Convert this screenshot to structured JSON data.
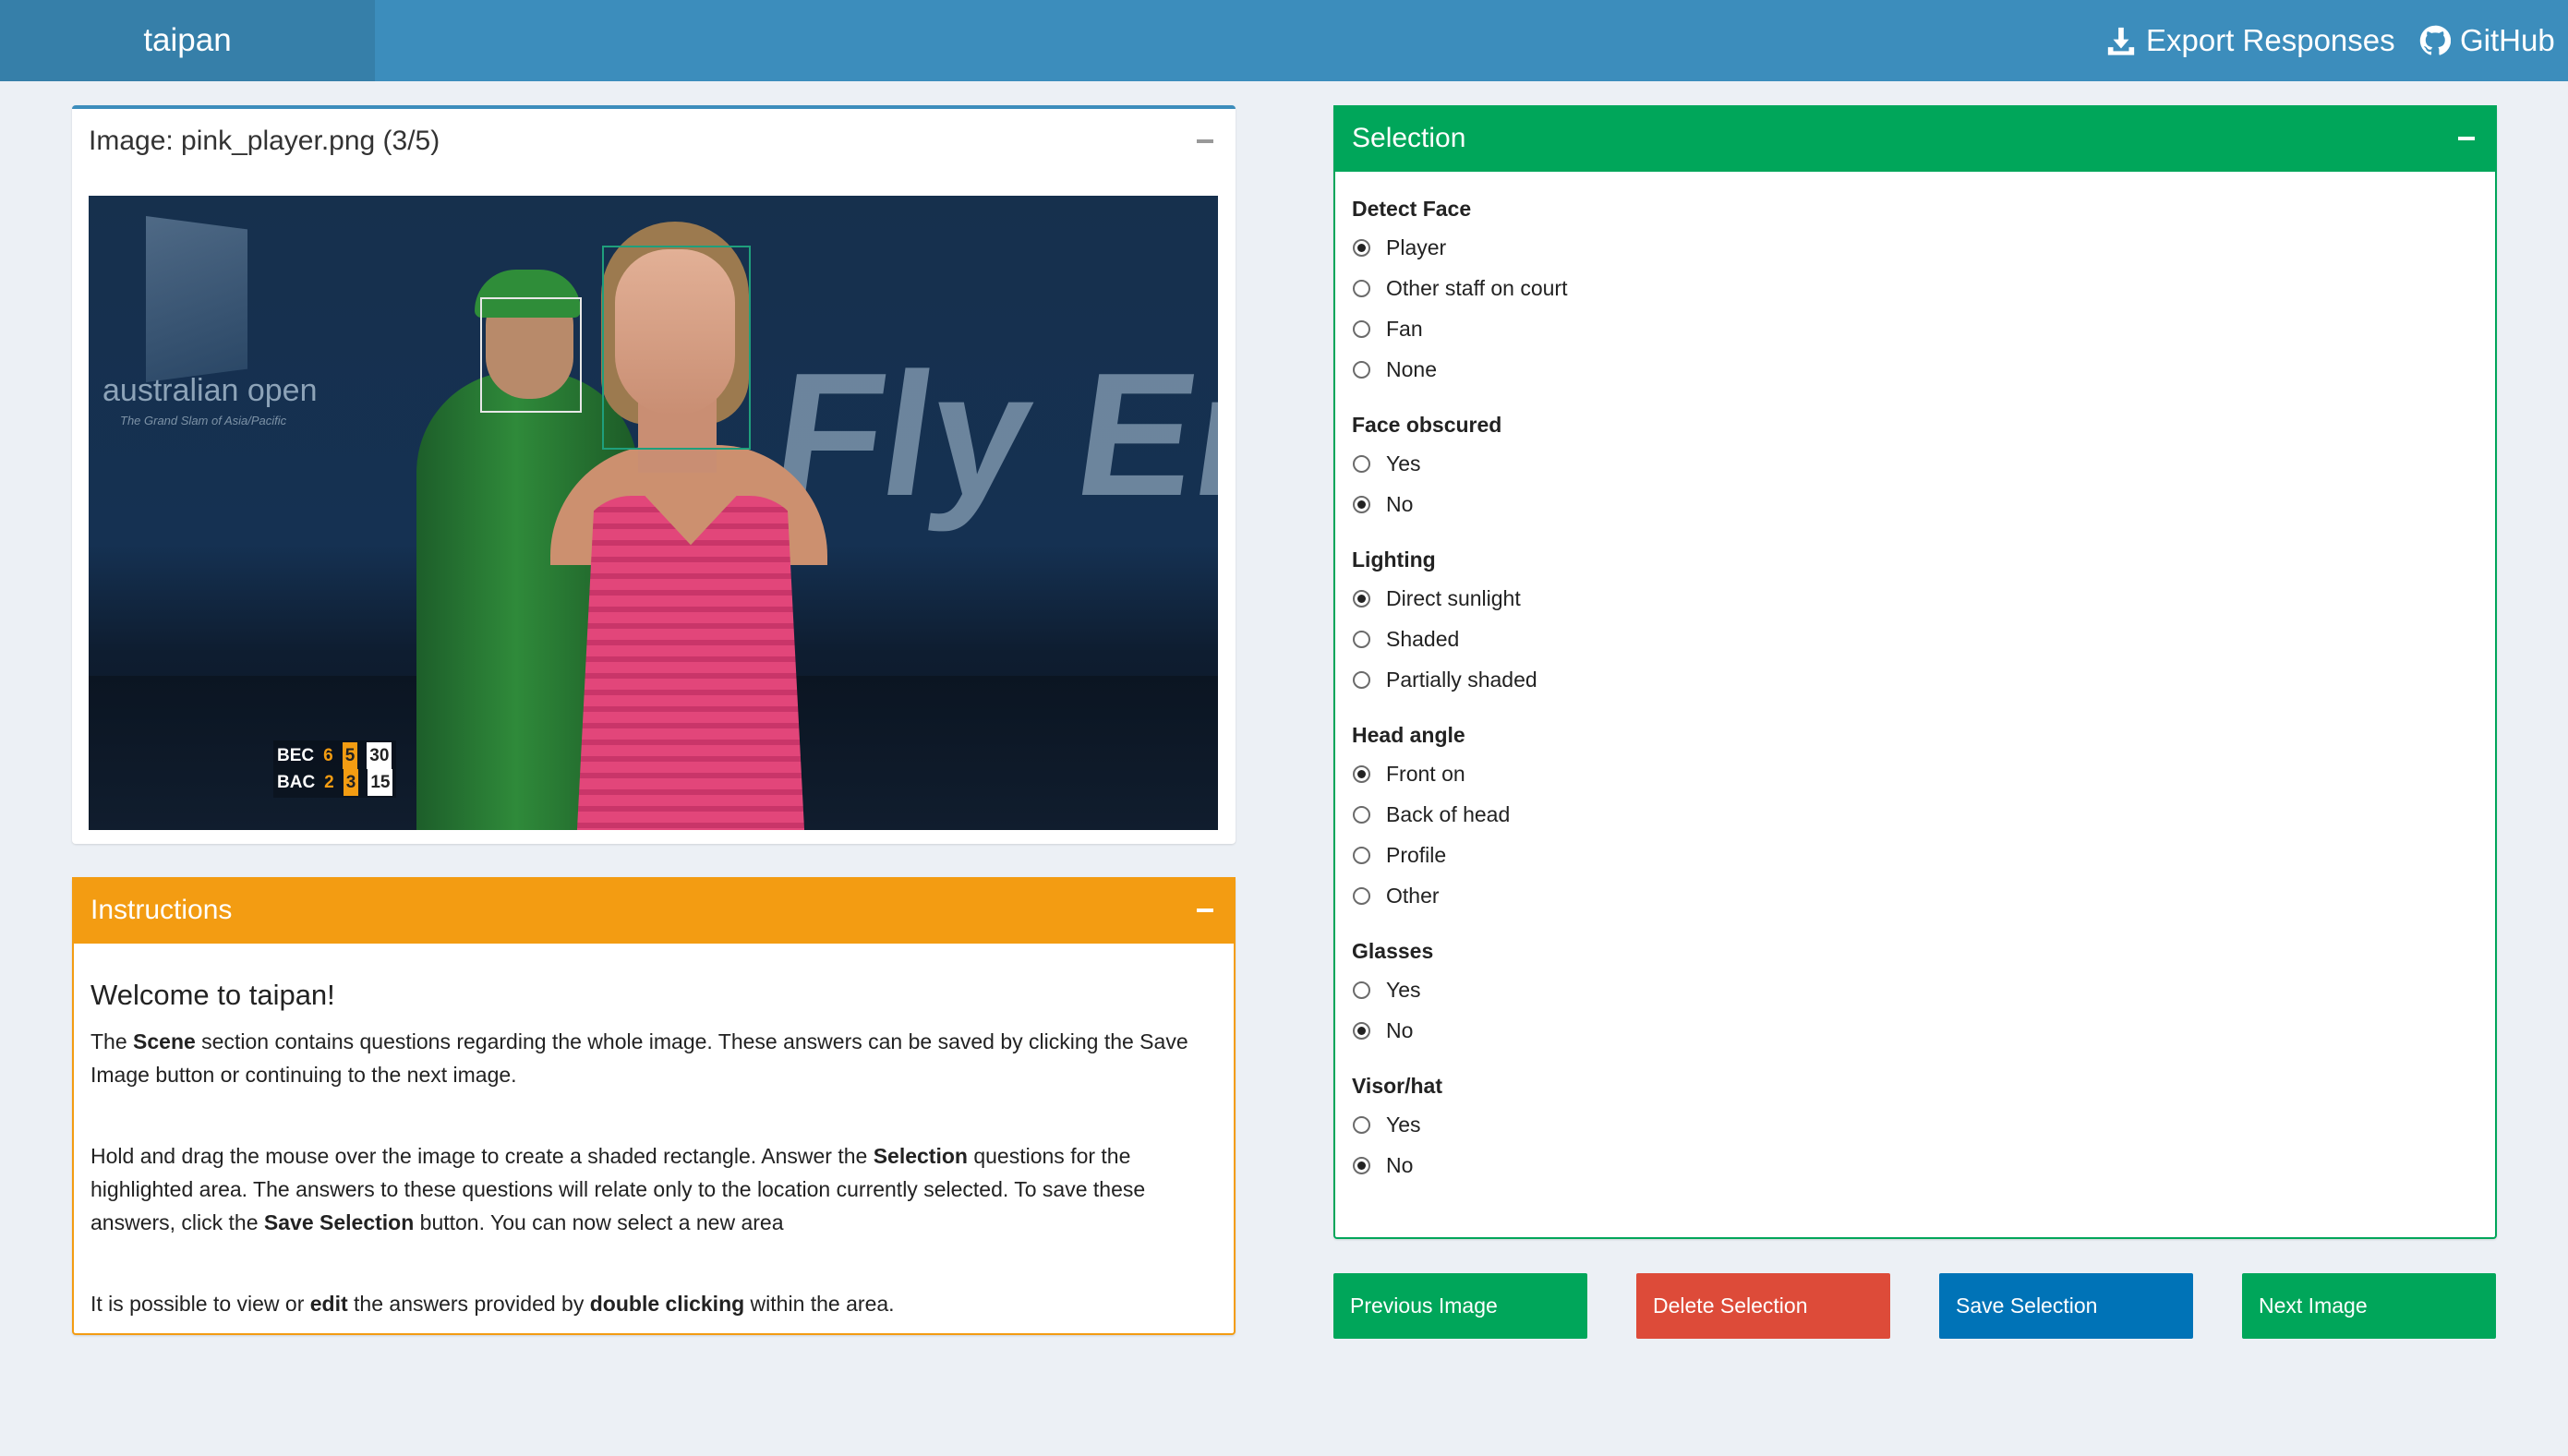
{
  "app": {
    "brand": "taipan"
  },
  "nav": {
    "export_label": "Export Responses",
    "export_icon": "download-icon",
    "github_label": "GitHub",
    "github_icon": "github-icon"
  },
  "image_panel": {
    "title": "Image: pink_player.png (3/5)",
    "overlay": {
      "logo_text": "australian open",
      "logo_subtext": "The Grand Slam of Asia/Pacific",
      "sponsor_text": "Fly Em",
      "scoreboard": [
        {
          "team": "BEC",
          "games": "6",
          "set": "5",
          "points": "30"
        },
        {
          "team": "BAC",
          "games": "2",
          "set": "3",
          "points": "15"
        }
      ]
    }
  },
  "instructions": {
    "header": "Instructions",
    "heading": "Welcome to taipan!",
    "p1": {
      "a": "The ",
      "b": "Scene",
      "c": " section contains questions regarding the whole image. These answers can be saved by clicking the Save Image button or continuing to the next image."
    },
    "p2": {
      "a": "Hold and drag the mouse over the image to create a shaded rectangle. Answer the ",
      "b": "Selection",
      "c": " questions for the highlighted area. The answers to these questions will relate only to the location currently selected. To save these answers, click the ",
      "d": "Save Selection",
      "e": " button. You can now select a new area"
    },
    "p3": {
      "a": "It is possible to view or ",
      "b": "edit",
      "c": " the answers provided by ",
      "d": "double clicking",
      "e": " within the area."
    }
  },
  "selection": {
    "header": "Selection",
    "questions": [
      {
        "label": "Detect Face",
        "options": [
          "Player",
          "Other staff on court",
          "Fan",
          "None"
        ],
        "selected": 0
      },
      {
        "label": "Face obscured",
        "options": [
          "Yes",
          "No"
        ],
        "selected": 1
      },
      {
        "label": "Lighting",
        "options": [
          "Direct sunlight",
          "Shaded",
          "Partially shaded"
        ],
        "selected": 0
      },
      {
        "label": "Head angle",
        "options": [
          "Front on",
          "Back of head",
          "Profile",
          "Other"
        ],
        "selected": 0
      },
      {
        "label": "Glasses",
        "options": [
          "Yes",
          "No"
        ],
        "selected": 1
      },
      {
        "label": "Visor/hat",
        "options": [
          "Yes",
          "No"
        ],
        "selected": 1
      }
    ]
  },
  "buttons": {
    "previous": "Previous Image",
    "delete": "Delete Selection",
    "save": "Save Selection",
    "next": "Next Image"
  },
  "colors": {
    "navbar": "#3c8dbc",
    "brand_bg": "#367fa9",
    "background": "#ecf0f5",
    "instructions_accent": "#f39c12",
    "selection_accent": "#00a65a",
    "previous_button": "#00a65a",
    "delete_button": "#dd4b39",
    "save_button": "#0073b7",
    "next_button": "#00a65a"
  }
}
